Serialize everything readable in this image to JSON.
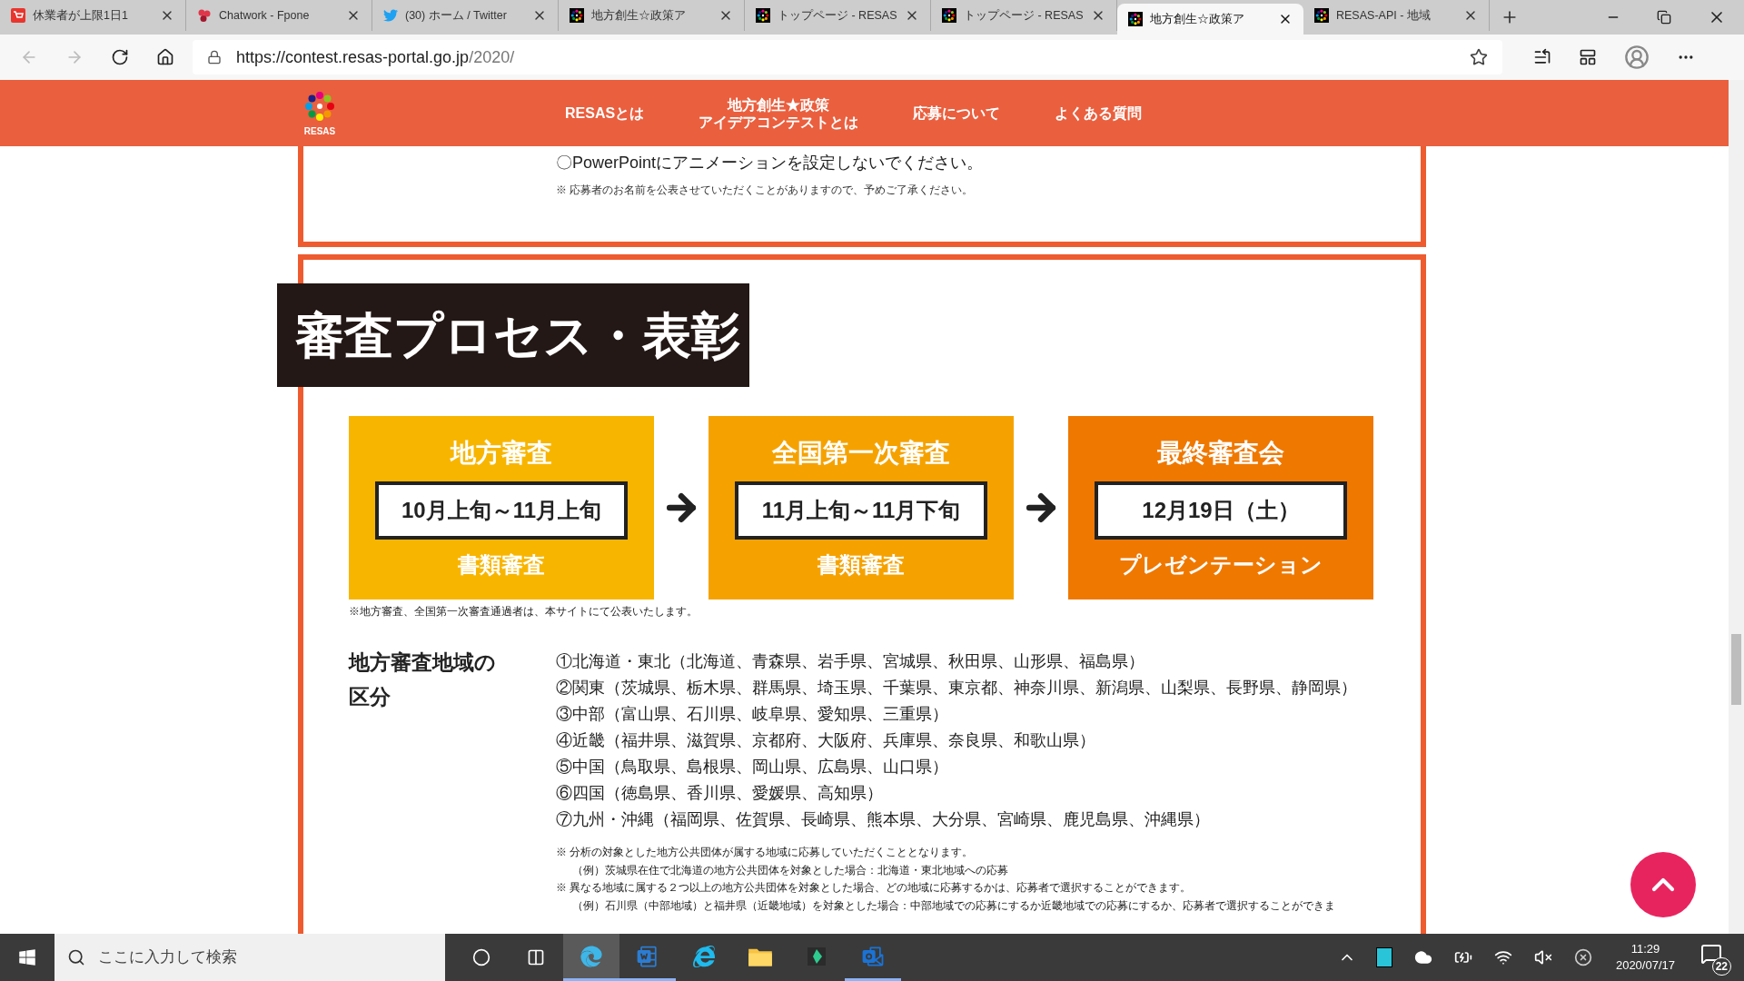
{
  "browser": {
    "tabs": [
      {
        "title": "休業者が上限1日1",
        "kind": "shop",
        "selected": false
      },
      {
        "title": "Chatwork - Fpone",
        "kind": "chat",
        "selected": false
      },
      {
        "title": "(30) ホーム / Twitter",
        "kind": "bird",
        "selected": false
      },
      {
        "title": "地方創生☆政策ア",
        "kind": "resas",
        "selected": false
      },
      {
        "title": "トップページ - RESAS",
        "kind": "resas",
        "selected": false
      },
      {
        "title": "トップページ - RESAS",
        "kind": "resas",
        "selected": false
      },
      {
        "title": "地方創生☆政策ア",
        "kind": "resas",
        "selected": true
      },
      {
        "title": "RESAS-API - 地域",
        "kind": "resas",
        "selected": false
      }
    ],
    "url_host": "https://contest.resas-portal.go.jp",
    "url_path": "/2020/"
  },
  "site_header": {
    "logo_text": "RESAS",
    "nav": [
      {
        "lines": [
          "RESASとは"
        ]
      },
      {
        "lines": [
          "地方創生★政策",
          "アイデアコンテストとは"
        ]
      },
      {
        "lines": [
          "応募について"
        ]
      },
      {
        "lines": [
          "よくある質問"
        ]
      }
    ]
  },
  "upload_rules": {
    "lines": [
      "〇PowerPointにアニメーションを設定しないでください。"
    ],
    "note": "※ 応募者のお名前を公表させていただくことがありますので、予めご了承ください。"
  },
  "section": {
    "title": "審査プロセス・表彰",
    "steps": [
      {
        "name": "地方審査",
        "period": "10月上旬～11月上旬",
        "detail": "書類審査",
        "color": "#f8b500"
      },
      {
        "name": "全国第一次審査",
        "period": "11月上旬～11月下旬",
        "detail": "書類審査",
        "color": "#f5a200"
      },
      {
        "name": "最終審査会",
        "period": "12月19日（土）",
        "detail": "プレゼンテーション",
        "color": "#ef7800"
      }
    ],
    "note": "※地方審査、全国第一次審査通過者は、本サイトにて公表いたします。",
    "regions": {
      "label": "地方審査地域の区分",
      "items": [
        "①北海道・東北（北海道、青森県、岩手県、宮城県、秋田県、山形県、福島県）",
        "②関東（茨城県、栃木県、群馬県、埼玉県、千葉県、東京都、神奈川県、新潟県、山梨県、長野県、静岡県）",
        "③中部（富山県、石川県、岐阜県、愛知県、三重県）",
        "④近畿（福井県、滋賀県、京都府、大阪府、兵庫県、奈良県、和歌山県）",
        "⑤中国（鳥取県、島根県、岡山県、広島県、山口県）",
        "⑥四国（徳島県、香川県、愛媛県、高知県）",
        "⑦九州・沖縄（福岡県、佐賀県、長崎県、熊本県、大分県、宮崎県、鹿児島県、沖縄県）"
      ],
      "notes": [
        "※ 分析の対象とした地方公共団体が属する地域に応募していただくこととなります。",
        "（例）茨城県在住で北海道の地方公共団体を対象とした場合：北海道・東北地域への応募",
        "※ 異なる地域に属する２つ以上の地方公共団体を対象とした場合、どの地域に応募するかは、応募者で選択することができます。",
        "（例）石川県（中部地域）と福井県（近畿地域）を対象とした場合：中部地域での応募にするか近畿地域での応募にするか、応募者で選択することができま"
      ]
    }
  },
  "taskbar": {
    "search_placeholder": "ここに入力して検索",
    "apps": [
      {
        "kind": "edge",
        "running": true,
        "selected": true
      },
      {
        "kind": "word",
        "running": true,
        "selected": false
      },
      {
        "kind": "ie",
        "running": false,
        "selected": false
      },
      {
        "kind": "folder",
        "running": false,
        "selected": false
      },
      {
        "kind": "diamond",
        "running": false,
        "selected": false
      },
      {
        "kind": "outlook",
        "running": true,
        "selected": false
      }
    ],
    "time": "11:29",
    "date": "2020/07/17",
    "notifications": "22"
  }
}
